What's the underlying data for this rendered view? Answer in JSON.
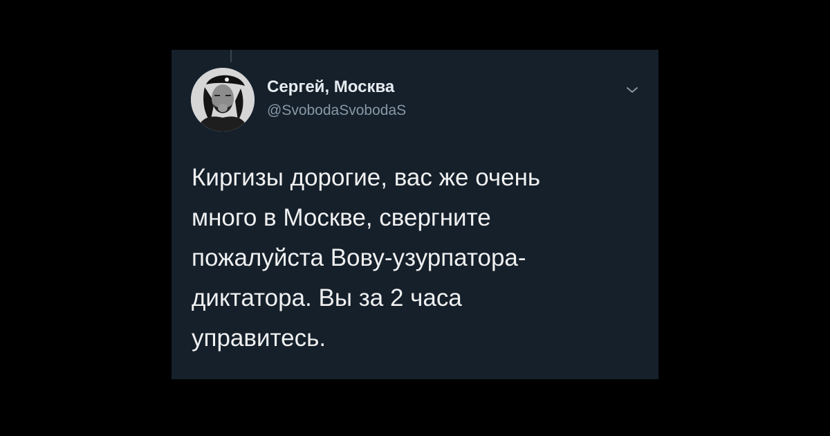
{
  "tweet": {
    "display_name": "Сергей, Москва",
    "handle": "@SvobodaSvobodaS",
    "text_lines": [
      "Киргизы дорогие, вас же очень",
      "много в Москве, свергните",
      "пожалуйста Вову-узурпатора-",
      "диктатора. Вы за 2 часа",
      "управитесь."
    ]
  },
  "icons": {
    "avatar": "user-avatar-photo",
    "menu": "chevron-down-icon"
  },
  "colors": {
    "page_background": "#000000",
    "card_background": "#15202b",
    "name_text": "#e6ecf0",
    "handle_text": "#8899a6",
    "body_text": "#f0f0f0"
  }
}
